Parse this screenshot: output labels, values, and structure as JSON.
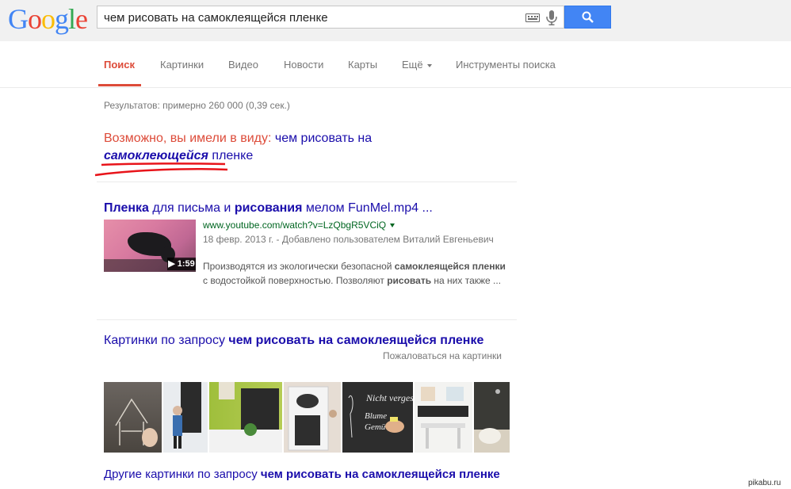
{
  "logo": "Google",
  "search": {
    "query": "чем рисовать на самоклеящейся пленке"
  },
  "nav": {
    "tabs": [
      "Поиск",
      "Картинки",
      "Видео",
      "Новости",
      "Карты",
      "Ещё",
      "Инструменты поиска"
    ]
  },
  "stats": "Результатов: примерно 260 000 (0,39 сек.)",
  "did_you_mean": {
    "lead": "Возможно, вы имели в виду:",
    "part1": "чем рисовать на",
    "corrected": "самоклеющейся",
    "part2": "пленке"
  },
  "result": {
    "title_b1": "Пленка",
    "title_t1": " для письма и ",
    "title_b2": "рисования",
    "title_t2": " мелом FunMel.mp4 ...",
    "duration": "▶ 1:59",
    "url": "www.youtube.com/watch?v=LzQbgR5VCiQ",
    "meta": "18 февр. 2013 г. - Добавлено пользователем Виталий Евгеньевич",
    "snip_1": "Производятся из экологически безопасной ",
    "snip_b1": "самоклеящейся пленки",
    "snip_2": " с водостойкой поверхностью. Позволяют ",
    "snip_b2": "рисовать",
    "snip_3": " на них также ..."
  },
  "images": {
    "title_prefix": "Картинки по запросу ",
    "title_query": "чем рисовать на самоклеящейся пленке",
    "report": "Пожаловаться на картинки",
    "thumb3_text1": "Nicht vergess",
    "thumb3_text2": "Blume",
    "thumb3_text3": "Gemü",
    "more_prefix": "Другие картинки по запросу ",
    "more_query": "чем рисовать на самоклеящейся пленке"
  },
  "watermark": "pikabu.ru",
  "colors": {
    "accent_red": "#dd4b39",
    "link_blue": "#1a0dab",
    "url_green": "#006621",
    "search_blue": "#4285f4",
    "annotation_red": "#e8141a"
  }
}
